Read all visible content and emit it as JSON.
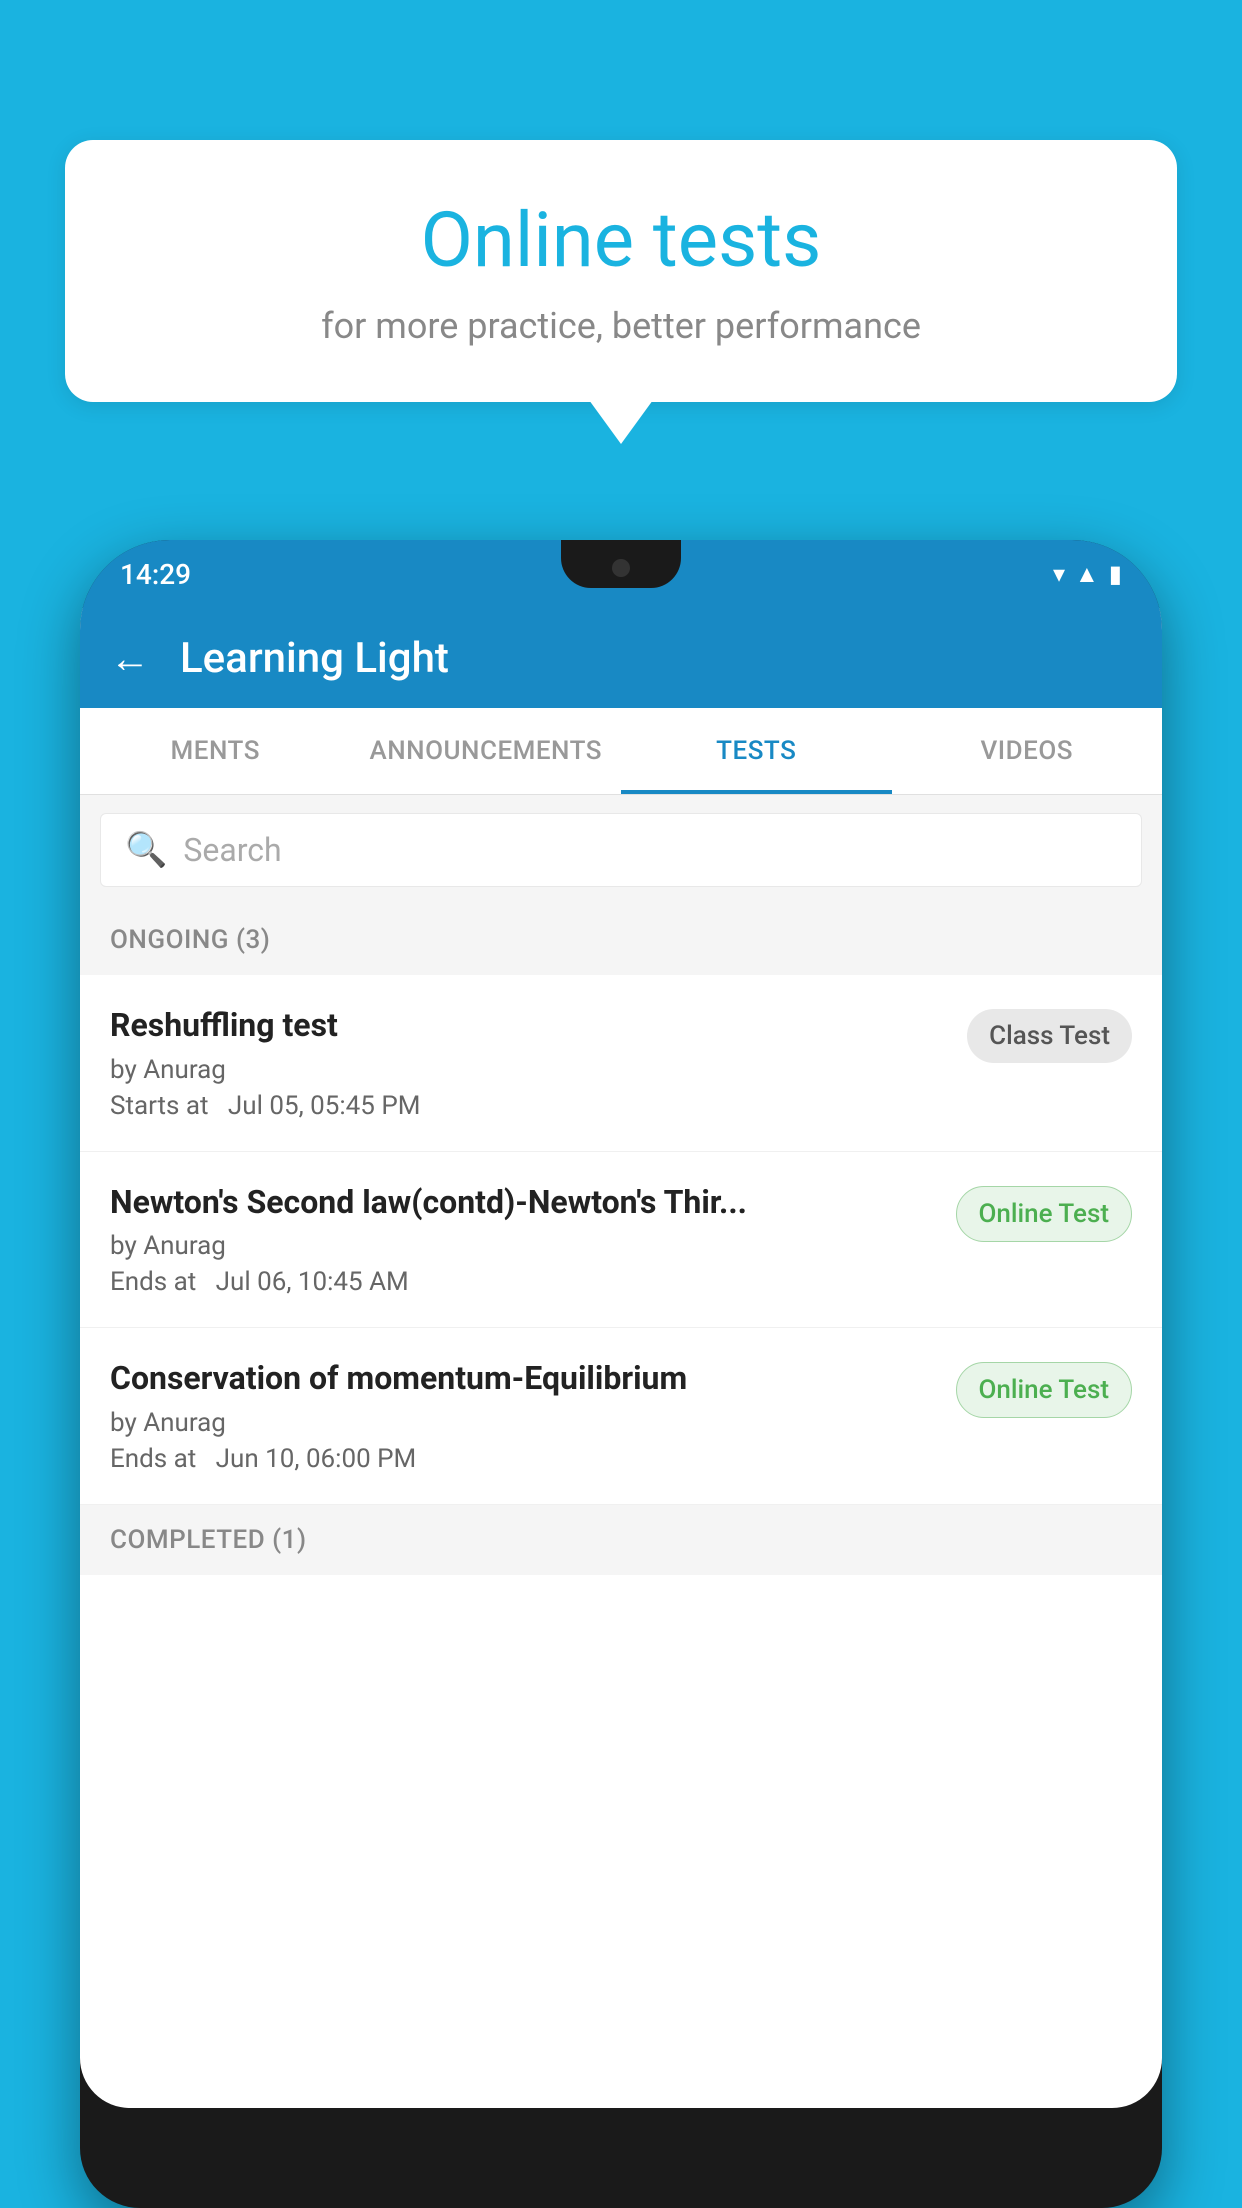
{
  "background_color": "#1ab3e0",
  "bubble": {
    "title": "Online tests",
    "subtitle": "for more practice, better performance"
  },
  "phone": {
    "status_bar": {
      "time": "14:29",
      "icons": [
        "wifi",
        "signal",
        "battery"
      ]
    },
    "app_bar": {
      "title": "Learning Light",
      "back_label": "←"
    },
    "tabs": [
      {
        "label": "MENTS",
        "active": false
      },
      {
        "label": "ANNOUNCEMENTS",
        "active": false
      },
      {
        "label": "TESTS",
        "active": true
      },
      {
        "label": "VIDEOS",
        "active": false
      }
    ],
    "search": {
      "placeholder": "Search"
    },
    "sections": [
      {
        "header": "ONGOING (3)",
        "items": [
          {
            "name": "Reshuffling test",
            "author": "by Anurag",
            "date": "Starts at  Jul 05, 05:45 PM",
            "badge": "Class Test",
            "badge_type": "class"
          },
          {
            "name": "Newton's Second law(contd)-Newton's Thir...",
            "author": "by Anurag",
            "date": "Ends at  Jul 06, 10:45 AM",
            "badge": "Online Test",
            "badge_type": "online"
          },
          {
            "name": "Conservation of momentum-Equilibrium",
            "author": "by Anurag",
            "date": "Ends at  Jun 10, 06:00 PM",
            "badge": "Online Test",
            "badge_type": "online"
          }
        ]
      },
      {
        "header": "COMPLETED (1)",
        "items": []
      }
    ]
  }
}
